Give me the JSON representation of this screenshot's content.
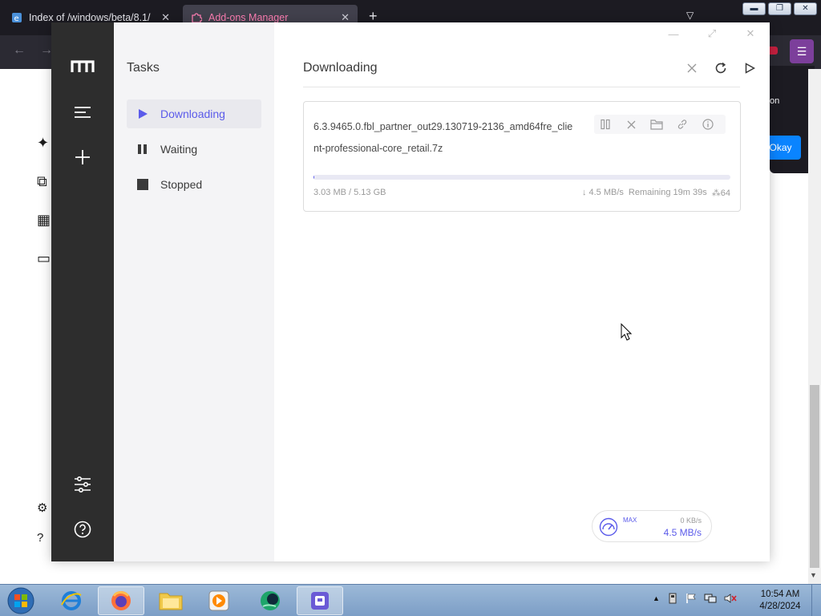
{
  "browser": {
    "tabs": [
      {
        "label": "Index of /windows/beta/8.1/"
      },
      {
        "label": "Add-ons Manager"
      }
    ],
    "popup_text": "on",
    "popup_button": "Okay"
  },
  "app": {
    "sidebar_title": "Tasks",
    "task_filters": [
      {
        "label": "Downloading",
        "icon": "play-icon",
        "active": true
      },
      {
        "label": "Waiting",
        "icon": "pause-icon",
        "active": false
      },
      {
        "label": "Stopped",
        "icon": "stop-icon",
        "active": false
      }
    ],
    "main_title": "Downloading",
    "tasks": [
      {
        "name": "6.3.9465.0.fbl_partner_out29.130719-2136_amd64fre_client-professional-core_retail.7z",
        "downloaded": "3.03 MB / 5.13 GB",
        "speed": "4.5 MB/s",
        "remaining": "Remaining 19m 39s",
        "connections": "64",
        "progress_percent": 0.06
      }
    ],
    "speedometer": {
      "label": "MAX",
      "upload": "0 KB/s",
      "download": "4.5 MB/s"
    },
    "accent_color": "#5b5bea"
  },
  "taskbar": {
    "time": "10:54 AM",
    "date": "4/28/2024"
  }
}
